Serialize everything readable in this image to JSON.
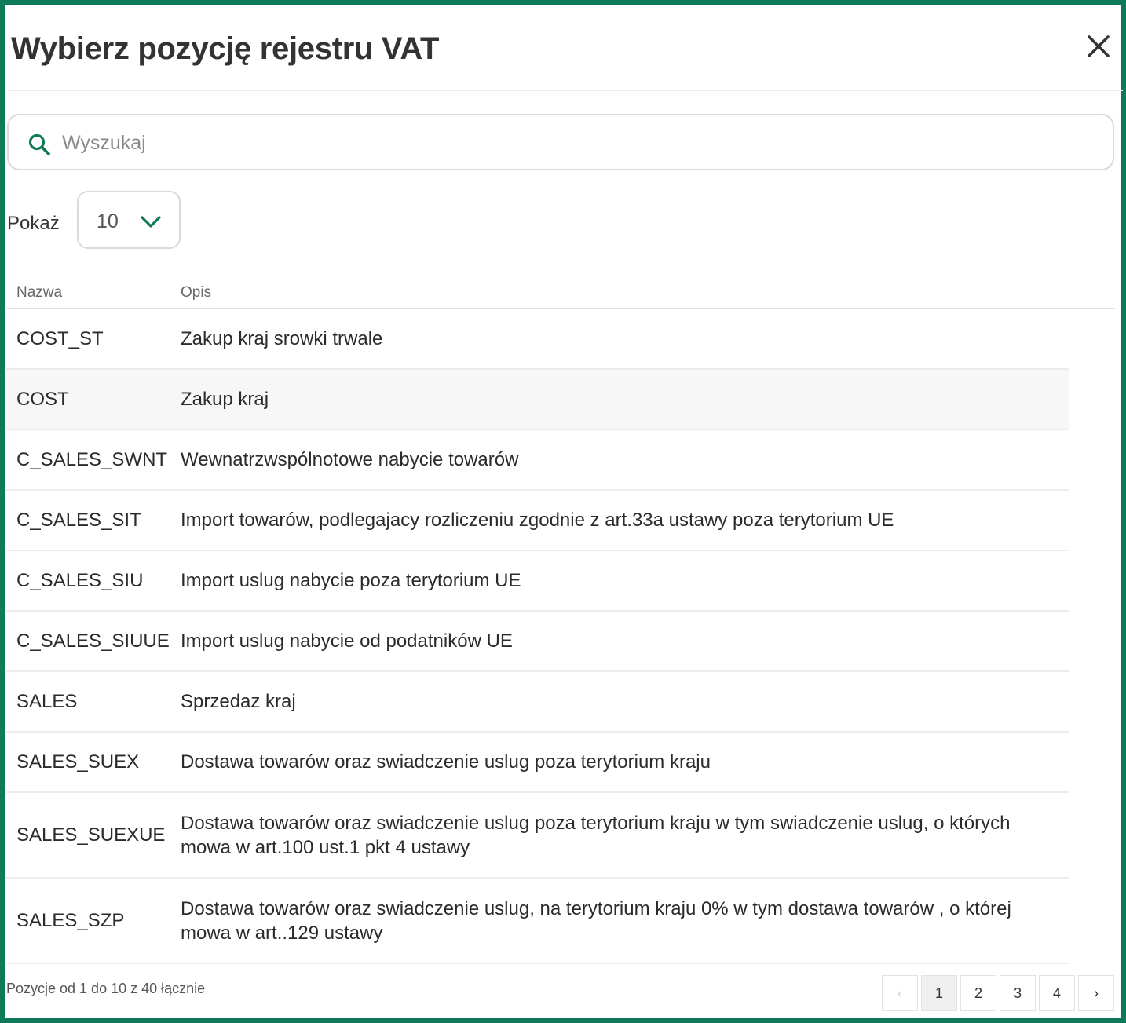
{
  "dialog": {
    "title": "Wybierz pozycję rejestru VAT"
  },
  "search": {
    "placeholder": "Wyszukaj",
    "value": ""
  },
  "page_size": {
    "label": "Pokaż",
    "selected": "10"
  },
  "table": {
    "columns": [
      "Nazwa",
      "Opis"
    ],
    "rows": [
      {
        "name": "COST_ST",
        "description": "Zakup kraj srowki trwale"
      },
      {
        "name": "COST",
        "description": "Zakup kraj"
      },
      {
        "name": "C_SALES_SWNT",
        "description": "Wewnatrzwspólnotowe nabycie towarów"
      },
      {
        "name": "C_SALES_SIT",
        "description": "Import towarów, podlegajacy rozliczeniu zgodnie z art.33a ustawy poza terytorium UE"
      },
      {
        "name": "C_SALES_SIU",
        "description": "Import uslug nabycie poza terytorium UE"
      },
      {
        "name": "C_SALES_SIUUE",
        "description": "Import uslug nabycie od podatników UE"
      },
      {
        "name": "SALES",
        "description": "Sprzedaz kraj"
      },
      {
        "name": "SALES_SUEX",
        "description": "Dostawa towarów oraz swiadczenie uslug poza terytorium kraju"
      },
      {
        "name": "SALES_SUEXUE",
        "description": "Dostawa towarów oraz swiadczenie uslug poza terytorium kraju w tym swiadczenie uslug, o których mowa w art.100 ust.1 pkt 4 ustawy"
      },
      {
        "name": "SALES_SZP",
        "description": "Dostawa towarów oraz swiadczenie uslug, na terytorium kraju 0% w tym dostawa towarów , o której mowa w art..129 ustawy"
      }
    ]
  },
  "footer": {
    "info": "Pozycje od 1 do 10 z 40 łącznie"
  },
  "pagination": {
    "prev": "‹",
    "next": "›",
    "pages": [
      "1",
      "2",
      "3",
      "4"
    ],
    "current": "1"
  },
  "colors": {
    "accent": "#0f7a5a",
    "border": "#d9d9d9",
    "row_alt": "#f7f7f7"
  }
}
